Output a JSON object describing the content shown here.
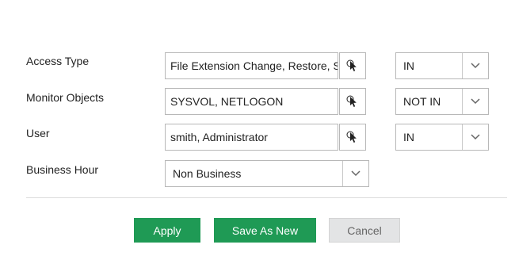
{
  "rows": {
    "access_type": {
      "label": "Access Type",
      "value": "File Extension Change, Restore, S",
      "operator": "IN"
    },
    "monitor_objects": {
      "label": "Monitor Objects",
      "value": "SYSVOL, NETLOGON",
      "operator": "NOT IN"
    },
    "user": {
      "label": "User",
      "value": "smith, Administrator",
      "operator": "IN"
    },
    "business_hour": {
      "label": "Business Hour",
      "value": "Non Business"
    }
  },
  "buttons": {
    "apply": "Apply",
    "save_as_new": "Save As New",
    "cancel": "Cancel"
  },
  "colors": {
    "primary": "#1f9a55",
    "cancel_bg": "#e3e4e5",
    "border": "#b8b8b8"
  }
}
